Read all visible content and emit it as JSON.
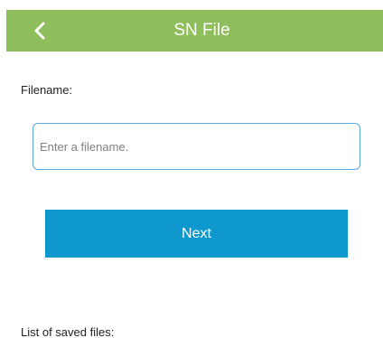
{
  "header": {
    "title": "SN File",
    "back_icon": "chevron-left-icon",
    "background_color": "#8fbf5d"
  },
  "form": {
    "filename_label": "Filename:",
    "filename_input": {
      "value": "",
      "placeholder": "Enter a filename."
    },
    "next_label": "Next",
    "accent_color": "#0f98ce"
  },
  "saved_files": {
    "label": "List of saved files:"
  }
}
